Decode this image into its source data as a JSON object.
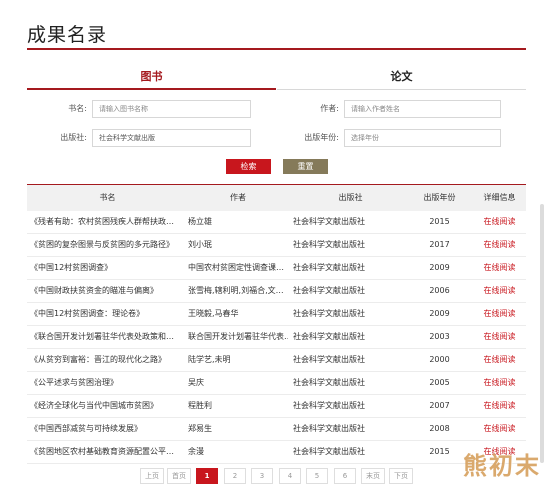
{
  "page": {
    "title": "成果名录"
  },
  "tabs": {
    "books": "图书",
    "papers": "论文"
  },
  "form": {
    "title_label": "书名:",
    "title_placeholder": "请输入图书名称",
    "author_label": "作者:",
    "author_placeholder": "请输入作者姓名",
    "publisher_label": "出版社:",
    "publisher_value": "社会科学文献出版",
    "year_label": "出版年份:",
    "year_placeholder": "选择年份",
    "search_label": "检索",
    "reset_label": "重置"
  },
  "table": {
    "headers": {
      "title": "书名",
      "author": "作者",
      "publisher": "出版社",
      "year": "出版年份",
      "details": "详细信息"
    },
    "rows": [
      {
        "title": "《残者有助：农村贫困残疾人群帮扶政…",
        "author": "杨立雄",
        "publisher": "社会科学文献出版社",
        "year": "2015",
        "link": "在线阅读"
      },
      {
        "title": "《贫困的复杂图景与反贫困的多元路径》",
        "author": "刘小珉",
        "publisher": "社会科学文献出版社",
        "year": "2017",
        "link": "在线阅读"
      },
      {
        "title": "《中国12村贫困调查》",
        "author": "中国农村贫困定性调查课…",
        "publisher": "社会科学文献出版社",
        "year": "2009",
        "link": "在线阅读"
      },
      {
        "title": "《中国财政扶贫资金的瞄准与偏离》",
        "author": "张雪梅,辖利明,刘福合,文…",
        "publisher": "社会科学文献出版社",
        "year": "2006",
        "link": "在线阅读"
      },
      {
        "title": "《中国12村贫困调查：理论卷》",
        "author": "王晓毅,马春华",
        "publisher": "社会科学文献出版社",
        "year": "2009",
        "link": "在线阅读"
      },
      {
        "title": "《联合国开发计划署驻华代表处政策和…",
        "author": "联合国开发计划署驻华代表…",
        "publisher": "社会科学文献出版社",
        "year": "2003",
        "link": "在线阅读"
      },
      {
        "title": "《从贫穷到富裕：晋江的现代化之路》",
        "author": "陆学艺,未明",
        "publisher": "社会科学文献出版社",
        "year": "2000",
        "link": "在线阅读"
      },
      {
        "title": "《公平述求与贫困治理》",
        "author": "吴庆",
        "publisher": "社会科学文献出版社",
        "year": "2005",
        "link": "在线阅读"
      },
      {
        "title": "《经济全球化与当代中国城市贫困》",
        "author": "程胜利",
        "publisher": "社会科学文献出版社",
        "year": "2007",
        "link": "在线阅读"
      },
      {
        "title": "《中国西部减贫与可持续发展》",
        "author": "郑易生",
        "publisher": "社会科学文献出版社",
        "year": "2008",
        "link": "在线阅读"
      },
      {
        "title": "《贫困地区农村基础教育资源配置公平…",
        "author": "余漫",
        "publisher": "社会科学文献出版社",
        "year": "2015",
        "link": "在线阅读"
      }
    ]
  },
  "pagination": {
    "first": "上页",
    "home": "首页",
    "pages": [
      "1",
      "2",
      "3",
      "4",
      "5",
      "6"
    ],
    "last": "末页",
    "next": "下页",
    "current": "1"
  },
  "watermark": {
    "text": "熊初末"
  }
}
